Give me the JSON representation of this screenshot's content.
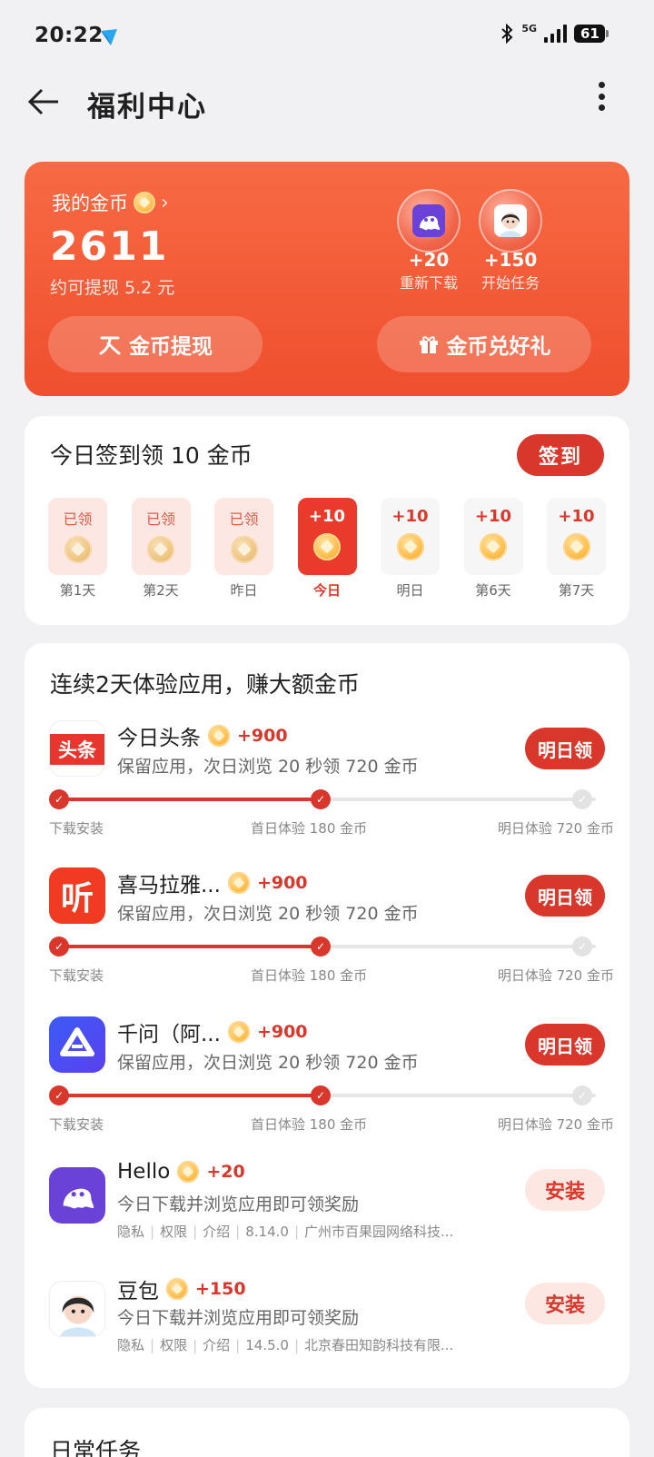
{
  "status": {
    "time": "20:22",
    "network": "5G",
    "battery": "61"
  },
  "header": {
    "title": "福利中心"
  },
  "coins": {
    "label": "我的金币",
    "balance": "2611",
    "withdraw_estimate": "约可提现 5.2 元",
    "tasks": [
      {
        "value": "+20",
        "caption": "重新下载"
      },
      {
        "value": "+150",
        "caption": "开始任务"
      }
    ],
    "buttons": {
      "withdraw": "金币提现",
      "exchange": "金币兑好礼"
    }
  },
  "checkin": {
    "title": "今日签到领 10 金币",
    "button": "签到",
    "days": [
      {
        "label": "已领",
        "name": "第1天",
        "state": "claimed"
      },
      {
        "label": "已领",
        "name": "第2天",
        "state": "claimed"
      },
      {
        "label": "已领",
        "name": "昨日",
        "state": "claimed"
      },
      {
        "label": "+10",
        "name": "今日",
        "state": "today"
      },
      {
        "label": "+10",
        "name": "明日",
        "state": "future"
      },
      {
        "label": "+10",
        "name": "第6天",
        "state": "future"
      },
      {
        "label": "+10",
        "name": "第7天",
        "state": "future"
      }
    ]
  },
  "apps_section": {
    "title": "连续2天体验应用，赚大额金币",
    "progress_labels": [
      "下载安装",
      "首日体验 180 金币",
      "明日体验 720 金币"
    ],
    "trial_apps": [
      {
        "name": "今日头条",
        "reward": "+900",
        "desc": "保留应用，次日浏览 20 秒领 720 金币",
        "action": "明日领",
        "icon_text": "头条"
      },
      {
        "name": "喜马拉雅...",
        "reward": "+900",
        "desc": "保留应用，次日浏览 20 秒领 720 金币",
        "action": "明日领",
        "icon_text": "听"
      },
      {
        "name": "千问（阿...",
        "reward": "+900",
        "desc": "保留应用，次日浏览 20 秒领 720 金币",
        "action": "明日领",
        "icon_text": ""
      }
    ],
    "install_apps": [
      {
        "name": "Hello",
        "reward": "+20",
        "desc": "今日下载并浏览应用即可领奖励",
        "meta": [
          "隐私",
          "权限",
          "介绍",
          "8.14.0",
          "广州市百果园网络科技..."
        ],
        "action": "安装"
      },
      {
        "name": "豆包",
        "reward": "+150",
        "desc": "今日下载并浏览应用即可领奖励",
        "meta": [
          "隐私",
          "权限",
          "介绍",
          "14.5.0",
          "北京春田知韵科技有限..."
        ],
        "action": "安装"
      }
    ]
  },
  "daily": {
    "title": "日常任务"
  }
}
